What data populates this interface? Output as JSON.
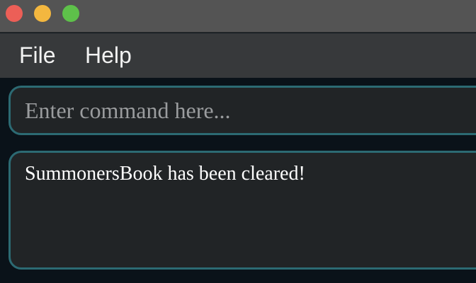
{
  "window": {
    "controls": [
      "close",
      "minimize",
      "zoom"
    ],
    "colors": {
      "close": "#ec5f57",
      "minimize": "#f3b73f",
      "zoom": "#5ec14a"
    }
  },
  "menu": {
    "file_label": "File",
    "help_label": "Help"
  },
  "command": {
    "value": "",
    "placeholder": "Enter command here..."
  },
  "result": {
    "text": "SummonersBook has been cleared!"
  },
  "theme": {
    "accent_border": "#2c6a73",
    "panel_bg": "#212426",
    "background": "#0a1219"
  }
}
